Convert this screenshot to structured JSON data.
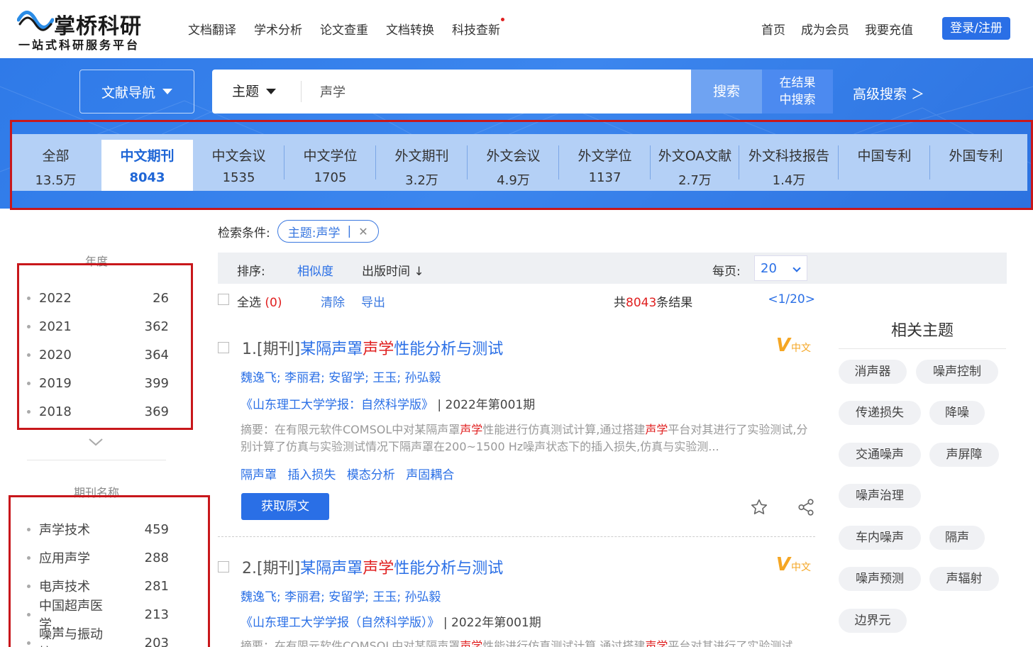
{
  "brand": {
    "name": "掌桥科研",
    "slogan": "一站式科研服务平台"
  },
  "top_nav": [
    "文档翻译",
    "学术分析",
    "论文查重",
    "文档转换",
    "科技查新"
  ],
  "right_nav": [
    "首页",
    "成为会员",
    "我要充值"
  ],
  "login": "登录/注册",
  "search": {
    "nav_label": "文献导航",
    "field": "主题",
    "query": "声学",
    "search_btn": "搜索",
    "within_line1": "在结果",
    "within_line2": "中搜索",
    "advanced": "高级搜索 ＞"
  },
  "tabs": [
    {
      "label": "全部",
      "count": "13.5万"
    },
    {
      "label": "中文期刊",
      "count": "8043",
      "active": true
    },
    {
      "label": "中文会议",
      "count": "1535"
    },
    {
      "label": "中文学位",
      "count": "1705"
    },
    {
      "label": "外文期刊",
      "count": "3.2万"
    },
    {
      "label": "外文会议",
      "count": "4.9万"
    },
    {
      "label": "外文学位",
      "count": "1137"
    },
    {
      "label": "外文OA文献",
      "count": "2.7万"
    },
    {
      "label": "外文科技报告",
      "count": "1.4万"
    },
    {
      "label": "中国专利",
      "count": ""
    },
    {
      "label": "外国专利",
      "count": ""
    }
  ],
  "sidebar": {
    "year_title": "年度",
    "years": [
      {
        "name": "2022",
        "count": "26"
      },
      {
        "name": "2021",
        "count": "362"
      },
      {
        "name": "2020",
        "count": "364"
      },
      {
        "name": "2019",
        "count": "399"
      },
      {
        "name": "2018",
        "count": "369"
      }
    ],
    "journal_title": "期刊名称",
    "journals": [
      {
        "name": "声学技术",
        "count": "459"
      },
      {
        "name": "应用声学",
        "count": "288"
      },
      {
        "name": "电声技术",
        "count": "281"
      },
      {
        "name": "中国超声医学...",
        "count": "213"
      },
      {
        "name": "噪声与振动控...",
        "count": "203"
      }
    ]
  },
  "conditions": {
    "label": "检索条件:",
    "tag": "主题:声学",
    "sep": "|",
    "remove": "✕"
  },
  "sort": {
    "label": "排序:",
    "similarity": "相似度",
    "date": "出版时间 ↓",
    "per_page_label": "每页:",
    "per_page": "20"
  },
  "toolbar": {
    "select_all": "全选",
    "selected": "(0)",
    "clear": "清除",
    "export": "导出",
    "total_prefix": "共",
    "total": "8043",
    "total_suffix": "条结果",
    "pager_open": "<",
    "page": "1/20",
    "pager_close": ">"
  },
  "results": [
    {
      "index": "1.",
      "kind": "[期刊]",
      "title_a": "某隔声罩",
      "title_hl": "声学",
      "title_b": "性能分析与测试",
      "badge_v": "V",
      "badge_lang": "中文",
      "authors": "魏逸飞;  李丽君;  安留学;  王玉;  孙弘毅",
      "journal": "《山东理工大学学报：自然科学版》",
      "issue": " | 2022年第001期",
      "abstract_a": "摘要：在有限元软件COMSOL中对某隔声罩",
      "abstract_hl1": "声学",
      "abstract_b": "性能进行仿真测试计算,通过搭建",
      "abstract_hl2": "声学",
      "abstract_c": "平台对其进行了实验测试,分别计算了仿真与实验测试情况下隔声罩在200~1500 Hz噪声状态下的插入损失,仿真与实验测...",
      "keywords": [
        "隔声罩",
        "插入损失",
        "模态分析",
        "声固耦合"
      ],
      "get_btn": "获取原文"
    },
    {
      "index": "2.",
      "kind": "[期刊]",
      "title_a": "某隔声罩",
      "title_hl": "声学",
      "title_b": "性能分析与测试",
      "badge_v": "V",
      "badge_lang": "中文",
      "authors": "魏逸飞;  李丽君;  安留学;  王玉;  孙弘毅",
      "journal": "《山东理工大学学报（自然科学版）》",
      "issue": " | 2022年第001期",
      "abstract_a": "摘要：在有限元软件COMSOL中对某隔声罩",
      "abstract_hl1": "声学",
      "abstract_b": "性能进行仿真测试计算,通过搭建",
      "abstract_hl2": "声学",
      "abstract_c": "平台对其进行了实验测试"
    }
  ],
  "related": {
    "title": "相关主题",
    "chips": [
      "消声器",
      "噪声控制",
      "传递损失",
      "降噪",
      "交通噪声",
      "声屏障",
      "噪声治理",
      "车内噪声",
      "隔声",
      "噪声预测",
      "声辐射",
      "边界元"
    ]
  },
  "colors": {
    "primary": "#2a6fe6",
    "band": "#3a82ec",
    "tabs_bg": "#b4d0f6",
    "highlight": "#e02020",
    "badge": "#f5a623",
    "annotation": "#c8171b"
  }
}
